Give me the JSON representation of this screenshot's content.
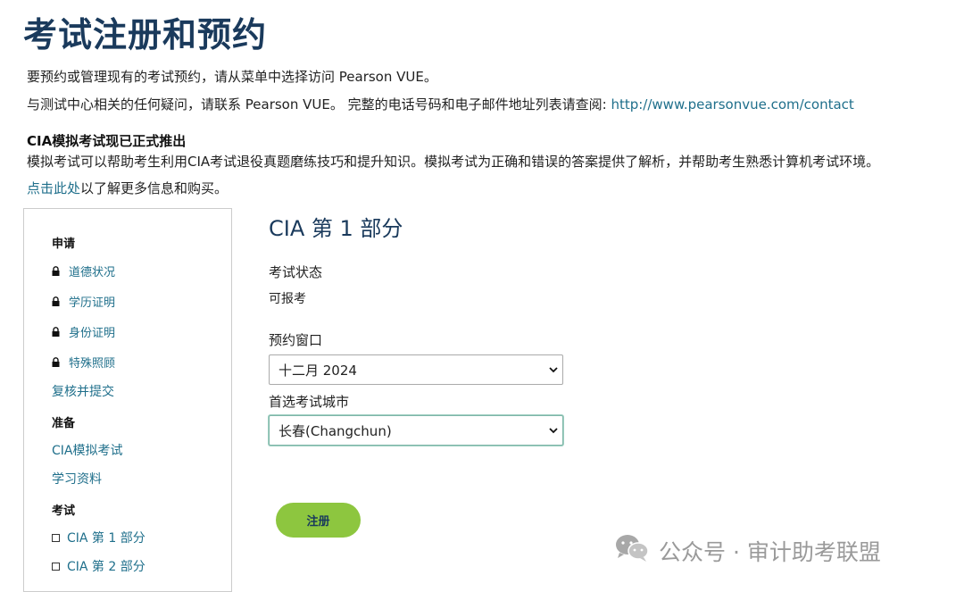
{
  "page": {
    "title": "考试注册和预约"
  },
  "intro": {
    "line1": "要预约或管理现有的考试预约，请从菜单中选择访问 Pearson VUE。",
    "line2_text": "与测试中心相关的任何疑问，请联系 Pearson VUE。 完整的电话号码和电子邮件地址列表请查阅: ",
    "line2_link": "http://www.pearsonvue.com/contact"
  },
  "promo": {
    "title": "CIA模拟考试现已正式推出",
    "text": "模拟考试可以帮助考生利用CIA考试退役真题磨练技巧和提升知识。模拟考试为正确和错误的答案提供了解析，并帮助考生熟悉计算机考试环境。",
    "link": "点击此处",
    "link_suffix": "以了解更多信息和购买。"
  },
  "sidebar": {
    "heading_apply": "申请",
    "apply_items": [
      {
        "label": "道德状况",
        "icon": "lock-icon"
      },
      {
        "label": "学历证明",
        "icon": "lock-icon"
      },
      {
        "label": "身份证明",
        "icon": "lock-icon"
      },
      {
        "label": "特殊照顾",
        "icon": "lock-icon"
      }
    ],
    "review_submit": "复核并提交",
    "heading_prepare": "准备",
    "prepare_items": [
      "CIA模拟考试",
      "学习资料"
    ],
    "heading_exam": "考试",
    "exam_items": [
      {
        "label": "CIA 第 1 部分",
        "icon": "checkbox-icon"
      },
      {
        "label": "CIA 第 2 部分",
        "icon": "checkbox-icon"
      }
    ]
  },
  "main": {
    "section_title": "CIA 第 1 部分",
    "status_label": "考试状态",
    "status_value": "可报考",
    "window_label": "预约窗口",
    "window_selected": "十二月 2024",
    "city_label": "首选考试城市",
    "city_selected": "长春(Changchun)",
    "register_button": "注册"
  },
  "watermark": {
    "text": "公众号 · 审计助考联盟",
    "icon": "wechat-icon"
  },
  "colors": {
    "title": "#1a3a5c",
    "link": "#1f6f8b",
    "button": "#8dc63f",
    "watermark": "#9a9a9a"
  }
}
